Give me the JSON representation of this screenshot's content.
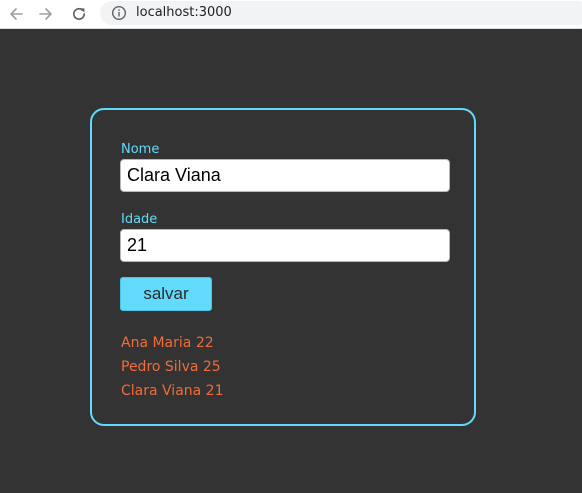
{
  "browser": {
    "url": "localhost:3000"
  },
  "form": {
    "name_label": "Nome",
    "name_value": "Clara Viana",
    "age_label": "Idade",
    "age_value": "21",
    "save_label": "salvar"
  },
  "people": [
    "Ana Maria 22",
    "Pedro Silva 25",
    "Clara Viana 21"
  ],
  "colors": {
    "background": "#333333",
    "accent": "#61dafb",
    "list_text": "#f26b3a"
  },
  "icons": [
    "back-arrow-icon",
    "forward-arrow-icon",
    "reload-icon",
    "info-icon"
  ]
}
